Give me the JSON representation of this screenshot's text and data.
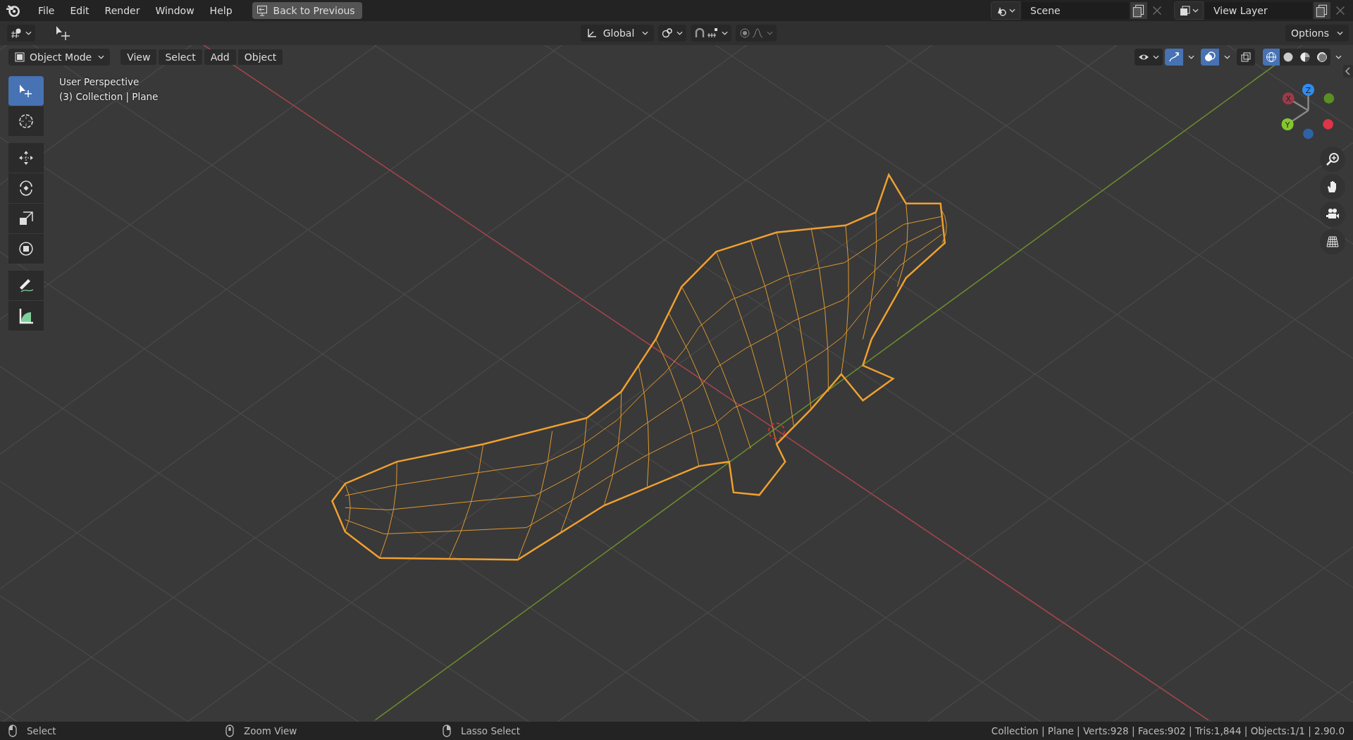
{
  "top_bar": {
    "menus": [
      {
        "label": "File"
      },
      {
        "label": "Edit"
      },
      {
        "label": "Render"
      },
      {
        "label": "Window"
      },
      {
        "label": "Help"
      }
    ],
    "back_button": "Back to Previous",
    "scene": {
      "value": "Scene"
    },
    "view_layer": {
      "value": "View Layer"
    }
  },
  "tool_header": {
    "orientation": "Global",
    "options": "Options"
  },
  "viewport_header": {
    "mode": "Object Mode",
    "menus": [
      {
        "label": "View"
      },
      {
        "label": "Select"
      },
      {
        "label": "Add"
      },
      {
        "label": "Object"
      }
    ],
    "shading_modes": [
      {
        "kind": "wireframe",
        "selected": true
      },
      {
        "kind": "solid",
        "selected": false
      },
      {
        "kind": "material",
        "selected": false
      },
      {
        "kind": "rendered",
        "selected": false
      }
    ]
  },
  "toolbar": [
    {
      "kind": "select",
      "selected": true
    },
    {
      "kind": "cursor",
      "selected": false
    },
    {
      "kind": "move",
      "selected": false
    },
    {
      "kind": "rotate",
      "selected": false
    },
    {
      "kind": "scale",
      "selected": false
    },
    {
      "kind": "transform",
      "selected": false
    },
    {
      "kind": "annotate",
      "selected": false
    },
    {
      "kind": "measure",
      "selected": false
    }
  ],
  "viewport_info": {
    "view": "User Perspective",
    "collection": "(3) Collection | Plane"
  },
  "gizmo": {
    "axes": [
      {
        "label": "X",
        "color": "#9b3a48"
      },
      {
        "label": "Z",
        "color": "#2f8cf0"
      },
      {
        "label": "Y",
        "color": "#84c72c"
      }
    ]
  },
  "status_bar": {
    "hints": [
      {
        "kind": "left",
        "label": "Select"
      },
      {
        "kind": "middle",
        "label": "Zoom View"
      },
      {
        "kind": "right",
        "label": "Lasso Select"
      }
    ],
    "stats": "Collection | Plane | Verts:928 | Faces:902 | Tris:1,844 | Objects:1/1 | 2.90.0"
  }
}
